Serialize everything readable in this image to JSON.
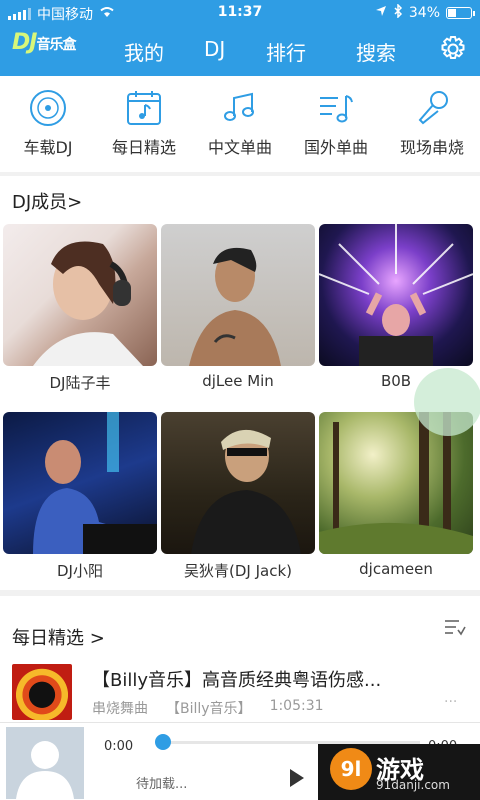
{
  "status_bar": {
    "carrier": "中国移动",
    "time": "11:37",
    "battery": "34%",
    "battery_level": 0.34
  },
  "header": {
    "logo_dj": "DJ",
    "logo_text": "音乐盒",
    "nav": [
      "我的",
      "DJ",
      "排行",
      "搜索"
    ]
  },
  "categories": [
    {
      "label": "车载DJ",
      "icon": "disc-icon"
    },
    {
      "label": "每日精选",
      "icon": "calendar-music-icon"
    },
    {
      "label": "中文单曲",
      "icon": "music-note-icon"
    },
    {
      "label": "国外单曲",
      "icon": "playlist-icon"
    },
    {
      "label": "现场串烧",
      "icon": "microphone-icon"
    }
  ],
  "dj_section": {
    "title": "DJ成员>"
  },
  "djs": [
    {
      "name": "DJ陆子丰"
    },
    {
      "name": "djLee Min"
    },
    {
      "name": "B0B"
    },
    {
      "name": "DJ小阳"
    },
    {
      "name": "吴狄青(DJ Jack)"
    },
    {
      "name": "djcameen"
    }
  ],
  "daily_section": {
    "title": "每日精选 >"
  },
  "song": {
    "title": "【Billy音乐】高音质经典粤语伤感...",
    "genre": "串烧舞曲",
    "artist": "【Billy音乐】",
    "duration": "1:05:31",
    "more": "..."
  },
  "player": {
    "current_time": "0:00",
    "total_time": "0:00",
    "status": "待加载...",
    "progress": 0
  },
  "watermark": {
    "text": "游戏",
    "num": "9l",
    "url": "91danji.com"
  },
  "colors": {
    "primary": "#2f9de4",
    "logo_accent": "#d8f77a"
  }
}
